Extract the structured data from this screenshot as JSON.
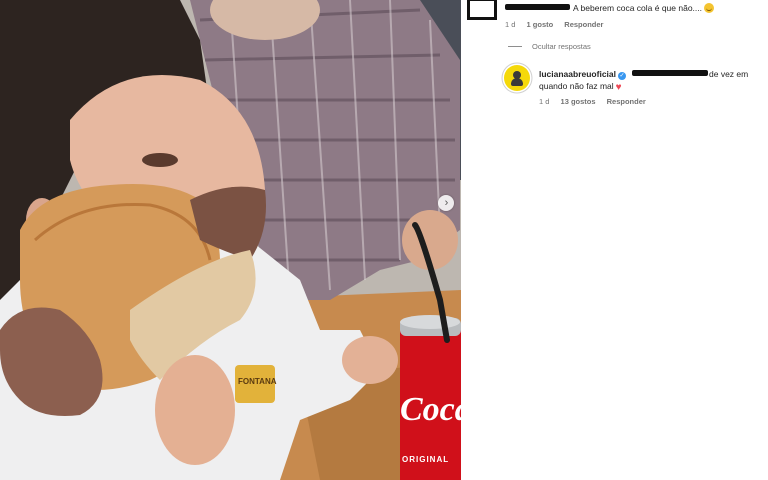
{
  "comment_top": {
    "text": "A beberem coca cola é que não....",
    "emoji": "slightly-smiling-face-emoji",
    "time": "1 d",
    "likes": "1 gosto",
    "reply_label": "Responder"
  },
  "hide_replies_label": "Ocultar respostas",
  "reply": {
    "username": "lucianaabreuoficial",
    "verified_icon": "verified-badge-icon",
    "text_line1_tail": "de vez em",
    "text_line2": "quando não faz mal",
    "heart_icon": "red-heart-emoji",
    "heart_color": "#ed4956",
    "time": "1 d",
    "likes": "13 gostos",
    "reply_label": "Responder"
  },
  "photo": {
    "can_label_top": "Coca",
    "can_label_bottom": "ORIGINAL",
    "shirt_text": "FONTANA",
    "can_color": "#d0101a",
    "next_icon": "chevron-right-icon"
  }
}
